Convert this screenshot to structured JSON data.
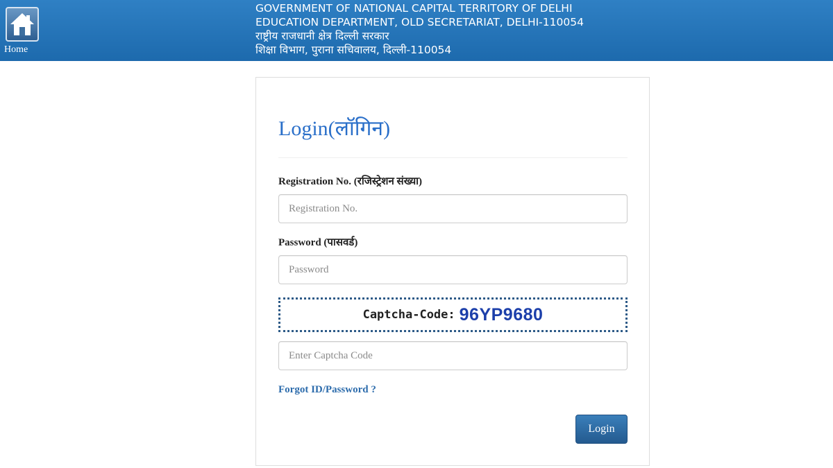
{
  "header": {
    "home_label": "Home",
    "home_icon": "home-icon",
    "lines": [
      "GOVERNMENT OF NATIONAL CAPITAL TERRITORY OF DELHI",
      "EDUCATION DEPARTMENT, OLD SECRETARIAT, DELHI-110054",
      "राष्ट्रीय राजधानी क्षेत्र दिल्ली सरकार",
      "शिक्षा विभाग, पुराना सचिवालय, दिल्ली-110054"
    ],
    "bg_color": "#1d6aad"
  },
  "login": {
    "title": "Login(लॉगिन)",
    "registration": {
      "label": "Registration No. (रजिस्ट्रेशन संख्या)",
      "placeholder": "Registration No.",
      "value": ""
    },
    "password": {
      "label": "Password (पासवर्ड)",
      "placeholder": "Password",
      "value": ""
    },
    "captcha": {
      "label": "Captcha-Code:",
      "code": "96YP9680",
      "input_placeholder": "Enter Captcha Code",
      "input_value": ""
    },
    "forgot_label": "Forgot ID/Password ?",
    "submit_label": "Login",
    "accent_color": "#2a6fc9",
    "button_color": "#245a8f"
  }
}
